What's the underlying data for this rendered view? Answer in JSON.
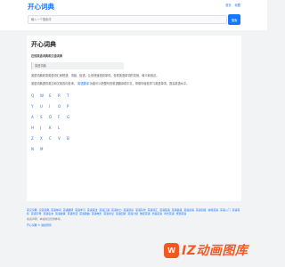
{
  "header": {
    "logo": "开心词典",
    "links": [
      "首页",
      "收藏"
    ],
    "search_placeholder": "输入一个搜索词",
    "search_button": "搜索"
  },
  "main": {
    "title": "开心词典",
    "subtitle": "在线英语词典和汉语词典",
    "section_label": "英语词典",
    "para1": "英语词典收录英语词汇和短语、词组、俗语，让你快速找到单词，查看英语单词的发音、释义和用法。",
    "para2_before": "英语词典提供英汉和汉英双向查询，",
    "para2_link": "英语翻译",
    "para2_after": "功能可以把整句的英语翻译成中文，帮助你轻松学习英语单词，提高英语水平。",
    "letter_rows": [
      [
        "Q",
        "W",
        "E",
        "R",
        "T"
      ],
      [
        "Y",
        "U",
        "I",
        "O",
        "P"
      ],
      [
        "A",
        "S",
        "D",
        "F",
        "G"
      ],
      [
        "H",
        "J",
        "K",
        "L"
      ],
      [
        "Z",
        "X",
        "C",
        "V",
        "B"
      ],
      [
        "N",
        "M"
      ]
    ]
  },
  "footer": {
    "links": [
      "英汉词典",
      "汉英词典",
      "英语单词",
      "英语翻译",
      "英语学习",
      "英语语法",
      "英语口语",
      "英语听力",
      "英语阅读",
      "英语写作",
      "英语词汇",
      "英语短语",
      "英语俗语",
      "英语谚语",
      "英语词组",
      "常用英语",
      "英语入门",
      "英语音标",
      "英语字母",
      "英语名言",
      "英语故事",
      "英语笑话",
      "英语歌曲",
      "英语电影",
      "英语考试",
      "英语四级",
      "英语六级",
      "雅思英语",
      "托福英语",
      "商务英语",
      "旅游英语"
    ],
    "note": "免责声明：本站信息仅供参考。",
    "copy": "开心词典 © 版权所有"
  },
  "watermark": {
    "badge": "W",
    "text": "IZ动画图库"
  },
  "colors": {
    "accent": "#1677ff",
    "page_bg": "#f2f3f5",
    "watermark": "#f05a22"
  }
}
